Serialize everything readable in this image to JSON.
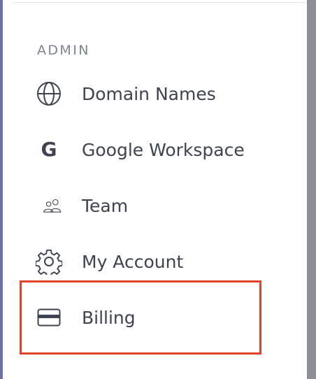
{
  "sidebar": {
    "section_title": "ADMIN",
    "items": [
      {
        "label": "Domain Names",
        "icon": "globe-icon"
      },
      {
        "label": "Google Workspace",
        "icon": "google-g-icon"
      },
      {
        "label": "Team",
        "icon": "team-icon"
      },
      {
        "label": "My Account",
        "icon": "gear-icon"
      },
      {
        "label": "Billing",
        "icon": "credit-card-icon"
      }
    ],
    "google_glyph": "G"
  },
  "colors": {
    "text": "#3d4350",
    "section_title": "#7b8594",
    "highlight": "#e0442a",
    "left_strip": "#6a70a8",
    "right_strip": "#8c8f97"
  }
}
